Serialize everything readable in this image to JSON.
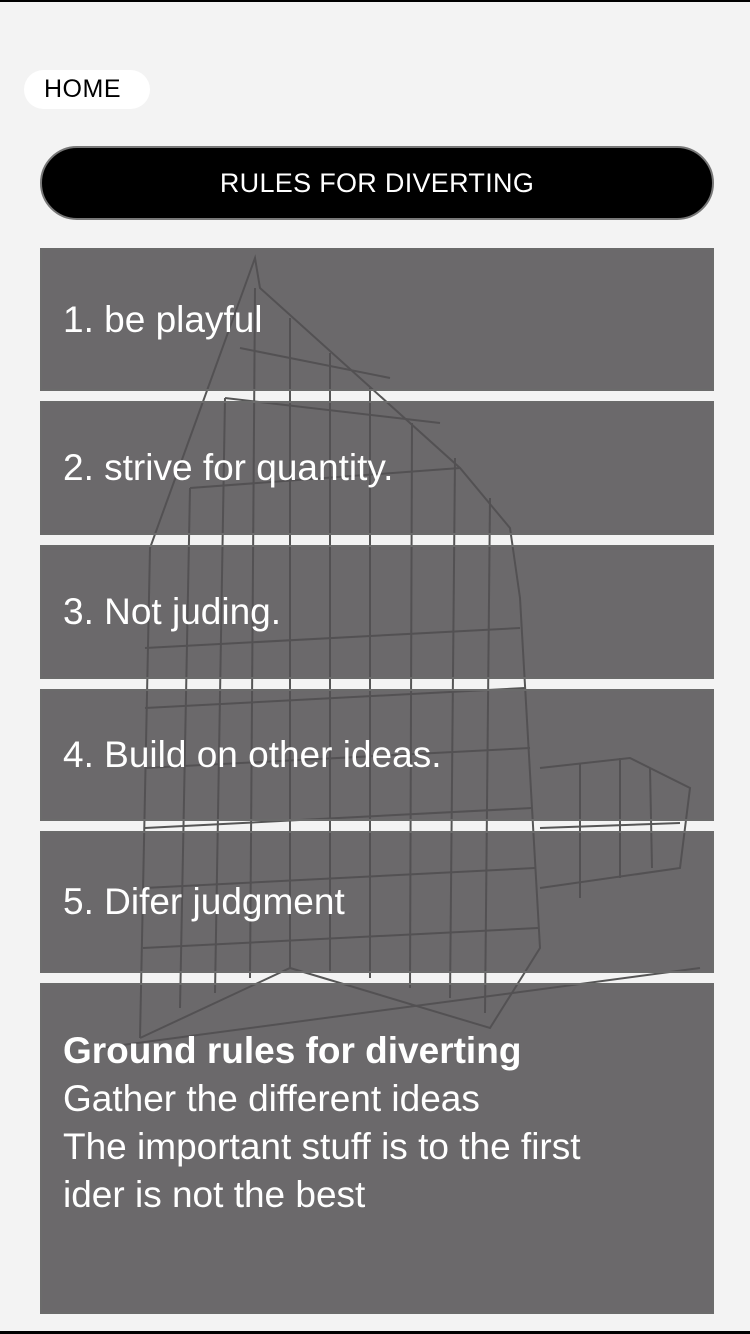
{
  "nav": {
    "home_label": "HOME"
  },
  "header": {
    "title": "RULES FOR DIVERTING"
  },
  "rules": [
    "1. be playful",
    "2. strive for quantity.",
    "3. Not juding.",
    "4. Build on other ideas.",
    "5. Difer judgment"
  ],
  "ground_rules": {
    "title": "Ground rules for diverting",
    "lines": [
      "Gather the different ideas",
      "The important stuff is to the first",
      "ider is not the best"
    ]
  },
  "colors": {
    "page_background": "#f3f3f3",
    "card_background": "#525052",
    "header_background": "#000000",
    "text_on_dark": "#ffffff"
  },
  "background_image": "building-perspective-sketch"
}
